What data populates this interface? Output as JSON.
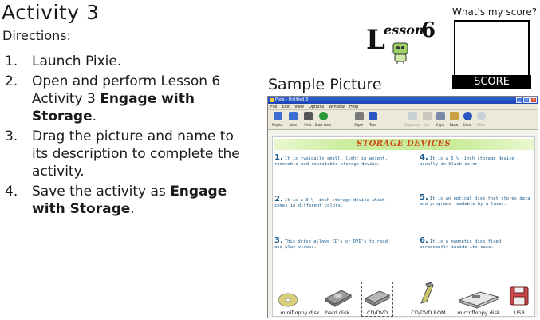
{
  "header": {
    "title": "Activity 3",
    "subtitle": "Directions:"
  },
  "steps": [
    {
      "num": "1.",
      "text": "Launch Pixie.",
      "bold": ""
    },
    {
      "num": "2.",
      "text": "Open and perform Lesson 6 Activity 3 ",
      "bold": "Engage with Storage",
      "after": "."
    },
    {
      "num": "3.",
      "text": "Drag the picture and name to its description to complete the activity.",
      "bold": ""
    },
    {
      "num": "4.",
      "text": "Save the activity as ",
      "bold": "Engage with Storage",
      "after": "."
    }
  ],
  "lesson_logo": {
    "word": "esson",
    "letter": "L",
    "number": "6"
  },
  "score": {
    "label": "What's my score?",
    "bar": "SCORE"
  },
  "sample": {
    "label": "Sample Picture"
  },
  "app": {
    "window_title": "Pixie - Untitled 3",
    "menu": [
      "File",
      "Edit",
      "View",
      "Options",
      "Window",
      "Help"
    ],
    "toolbar": [
      {
        "label": "Project",
        "icon": "project-icon",
        "color": "#3a6fd1"
      },
      {
        "label": "Save",
        "icon": "save-icon",
        "color": "#3a6fd1"
      },
      {
        "label": "Print",
        "icon": "print-icon",
        "color": "#555555"
      },
      {
        "label": "Start Over",
        "icon": "start-over-icon",
        "color": "#2a9a3a"
      },
      {
        "label": "Paper",
        "icon": "paper-icon",
        "color": "#7a7a7a"
      },
      {
        "label": "Text",
        "icon": "text-icon",
        "color": "#2b56c0"
      },
      {
        "label": "Duplicate",
        "icon": "duplicate-icon",
        "color": "#8aa7d6"
      },
      {
        "label": "Cut",
        "icon": "cut-icon",
        "color": "#8a8a8a"
      },
      {
        "label": "Copy",
        "icon": "copy-icon",
        "color": "#7a8aa8"
      },
      {
        "label": "Paste",
        "icon": "paste-icon",
        "color": "#c9a040"
      },
      {
        "label": "Undo",
        "icon": "undo-icon",
        "color": "#2b56c0"
      },
      {
        "label": "Redo",
        "icon": "redo-icon",
        "color": "#8aa7d6"
      }
    ]
  },
  "activity": {
    "banner": "STORAGE DEVICES",
    "descriptions": [
      {
        "n": "1.",
        "text": "It is typically small, light in weight, removable and rewritable storage device."
      },
      {
        "n": "4.",
        "text": "It is a 5 ¼ -inch storage device usually in black color."
      },
      {
        "n": "2.",
        "text": "It is a 3 ½ -inch storage device which comes in different colors."
      },
      {
        "n": "5.",
        "text": "It is an optical disk that stores data and programs readable by a laser."
      },
      {
        "n": "3.",
        "text": "This drive allows CD's or DVD's to read and play videos."
      },
      {
        "n": "6.",
        "text": "It is a magnetic disk fixed permanently inside its case."
      }
    ],
    "items": [
      {
        "caption": "minifloppy disk",
        "icon": "cd-disc-icon"
      },
      {
        "caption": "hard disk",
        "icon": "hard-disk-icon"
      },
      {
        "caption": "CD/DVD",
        "icon": "cd-dvd-icon"
      },
      {
        "caption": "CD/DVD ROM",
        "icon": "cd-rom-drive-icon"
      },
      {
        "caption": "microfloppy disk",
        "icon": "microfloppy-disk-icon"
      },
      {
        "caption": "USB",
        "icon": "usb-drive-icon"
      }
    ]
  }
}
